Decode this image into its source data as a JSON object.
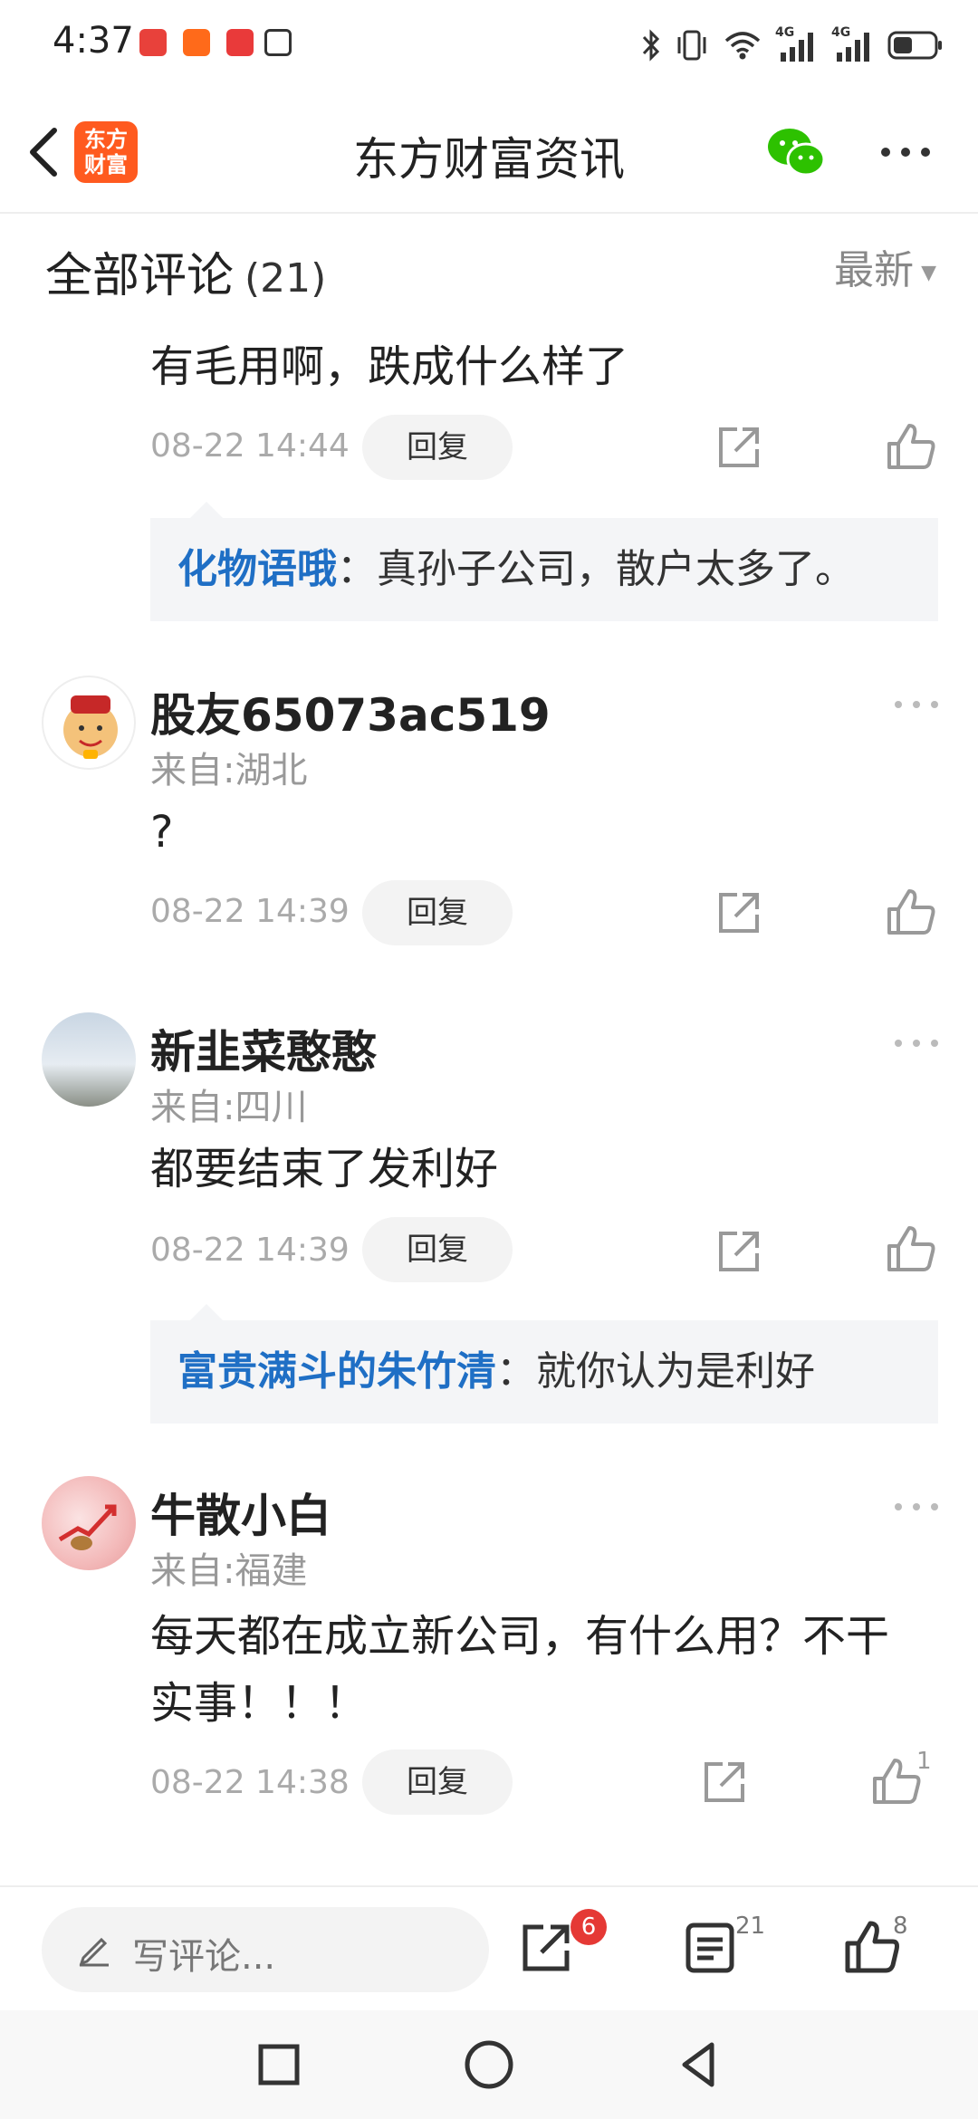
{
  "status_bar": {
    "time": "4:37",
    "network_label_1": "4G",
    "network_label_2": "4G"
  },
  "header": {
    "logo_line1": "东方",
    "logo_line2": "财富",
    "title": "东方财富资讯"
  },
  "comments_section": {
    "title": "全部评论",
    "count": "(21)",
    "sort_label": "最新"
  },
  "comments": [
    {
      "text": "有毛用啊，跌成什么样了",
      "time": "08-22 14:44",
      "reply_label": "回复",
      "reply": {
        "user": "化物语哦",
        "text": "：真孙子公司，散户太多了。"
      }
    },
    {
      "name": "股友65073ac519",
      "location": "来自:湖北",
      "text": "?",
      "time": "08-22 14:39",
      "reply_label": "回复"
    },
    {
      "name": "新韭菜憨憨",
      "location": "来自:四川",
      "text": "都要结束了发利好",
      "time": "08-22 14:39",
      "reply_label": "回复",
      "reply": {
        "user": "富贵满斗的朱竹清",
        "text": "：就你认为是利好"
      }
    },
    {
      "name": "牛散小白",
      "location": "来自:福建",
      "text_line1": "每天都在成立新公司，有什么用？不干",
      "text_line2": "实事！！！",
      "time": "08-22 14:38",
      "reply_label": "回复",
      "like_count": "1"
    }
  ],
  "bottom_bar": {
    "input_placeholder": "写评论...",
    "share_badge": "6",
    "comment_count": "21",
    "like_count": "8"
  },
  "colors": {
    "brand": "#ff5a1f",
    "link_blue": "#1f6fc5",
    "badge_red": "#e53935"
  }
}
